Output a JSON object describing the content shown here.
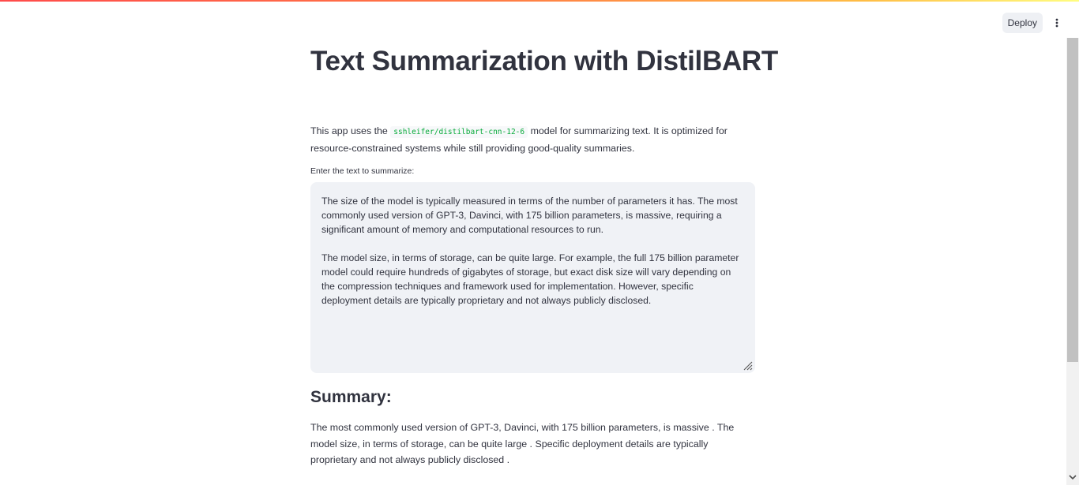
{
  "header": {
    "deploy_label": "Deploy",
    "menu_icon": "vertical-ellipsis-icon"
  },
  "main": {
    "title": "Text Summarization with DistilBART",
    "intro_before": "This app uses the ",
    "model_code": "sshleifer/distilbart-cnn-12-6",
    "intro_after": " model for summarizing text. It is optimized for resource-constrained systems while still providing good-quality summaries.",
    "input_label": "Enter the text to summarize:",
    "input_value": "The size of the model is typically measured in terms of the number of parameters it has. The most commonly used version of GPT-3, Davinci, with 175 billion parameters, is massive, requiring a significant amount of memory and computational resources to run.\n\nThe model size, in terms of storage, can be quite large. For example, the full 175 billion parameter model could require hundreds of gigabytes of storage, but exact disk size will vary depending on the compression techniques and framework used for implementation. However, specific deployment details are typically proprietary and not always publicly disclosed.",
    "summary_heading": "Summary:",
    "summary_text": "The most commonly used version of GPT-3, Davinci, with 175 billion parameters, is massive . The model size, in terms of storage, can be quite large . Specific deployment details are typically proprietary and not always publicly disclosed ."
  },
  "colors": {
    "code_text": "#09ab3b",
    "input_background": "#f0f2f6",
    "text": "#31333f"
  }
}
